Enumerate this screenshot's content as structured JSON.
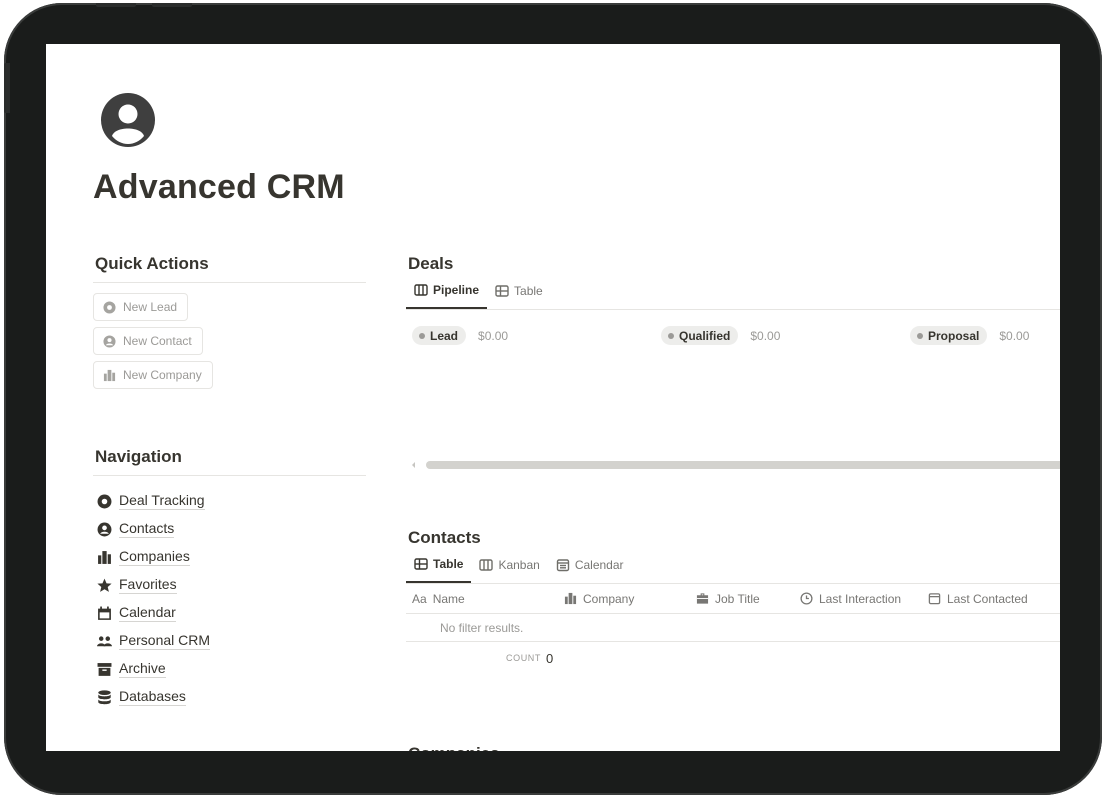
{
  "page": {
    "icon": "person-circle-icon",
    "title": "Advanced CRM"
  },
  "quick_actions": {
    "heading": "Quick Actions",
    "buttons": [
      {
        "label": "New Lead",
        "icon": "circle-icon"
      },
      {
        "label": "New Contact",
        "icon": "person-circle-icon"
      },
      {
        "label": "New Company",
        "icon": "buildings-icon"
      }
    ]
  },
  "navigation": {
    "heading": "Navigation",
    "items": [
      {
        "label": "Deal Tracking",
        "icon": "circle-icon"
      },
      {
        "label": "Contacts",
        "icon": "person-circle-icon"
      },
      {
        "label": "Companies",
        "icon": "buildings-icon"
      },
      {
        "label": "Favorites",
        "icon": "star-icon"
      },
      {
        "label": "Calendar",
        "icon": "calendar-icon"
      },
      {
        "label": "Personal CRM",
        "icon": "people-icon"
      },
      {
        "label": "Archive",
        "icon": "archive-icon"
      },
      {
        "label": "Databases",
        "icon": "database-icon"
      }
    ]
  },
  "deals": {
    "title": "Deals",
    "tabs": [
      {
        "label": "Pipeline",
        "icon": "columns-icon",
        "active": true
      },
      {
        "label": "Table",
        "icon": "table-icon",
        "active": false
      }
    ],
    "groups": [
      {
        "label": "Lead",
        "sum": "$0.00"
      },
      {
        "label": "Qualified",
        "sum": "$0.00"
      },
      {
        "label": "Proposal",
        "sum": "$0.00"
      }
    ]
  },
  "contacts": {
    "title": "Contacts",
    "tabs": [
      {
        "label": "Table",
        "icon": "table-icon",
        "active": true
      },
      {
        "label": "Kanban",
        "icon": "columns-icon",
        "active": false
      },
      {
        "label": "Calendar",
        "icon": "calendar-icon",
        "active": false
      }
    ],
    "columns": [
      {
        "label": "Name",
        "prefix": "Aa"
      },
      {
        "label": "Company",
        "icon": "buildings-icon"
      },
      {
        "label": "Job Title",
        "icon": "briefcase-icon"
      },
      {
        "label": "Last Interaction",
        "icon": "clock-icon"
      },
      {
        "label": "Last Contacted",
        "icon": "calendar-icon"
      }
    ],
    "empty_text": "No filter results.",
    "count_label": "COUNT",
    "count_value": "0"
  },
  "companies": {
    "title": "Companies"
  }
}
